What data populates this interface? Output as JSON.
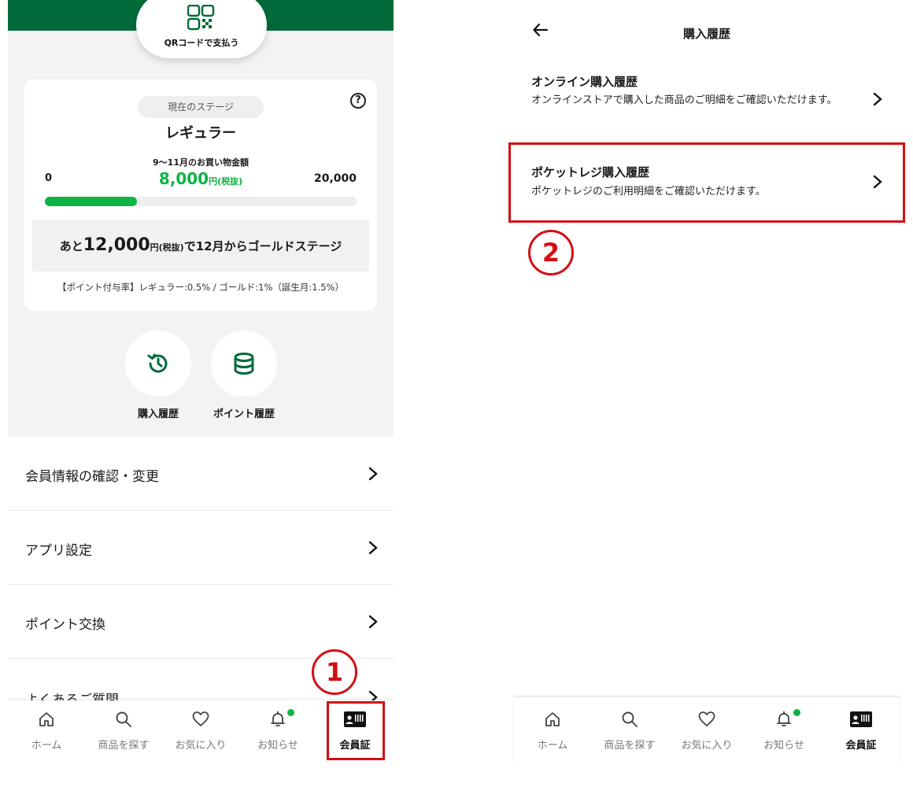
{
  "left": {
    "qr_label": "QRコードで支払う",
    "stage": {
      "badge": "現在のステージ",
      "name": "レギュラー",
      "period_label": "9〜11月のお買い物金額",
      "range_min": "0",
      "range_max": "20,000",
      "amount_value": "8,000",
      "amount_unit": "円(税抜)",
      "progress_fraction": 0.4,
      "remain_prefix": "あと",
      "remain_value": "12,000",
      "remain_unit": "円(税抜)",
      "remain_suffix": "で12月からゴールドステージ",
      "rate_note": "【ポイント付与率】レギュラー:0.5% / ゴールド:1%（誕生月:1.5%）"
    },
    "history_buttons": [
      {
        "label": "購入履歴",
        "icon": "history-icon"
      },
      {
        "label": "ポイント履歴",
        "icon": "database-icon"
      }
    ],
    "menu": [
      {
        "label": "会員情報の確認・変更"
      },
      {
        "label": "アプリ設定"
      },
      {
        "label": "ポイント交換"
      },
      {
        "label": "よくあるご質問"
      }
    ]
  },
  "tabbar": {
    "tabs": [
      {
        "label": "ホーム",
        "icon": "home-icon"
      },
      {
        "label": "商品を探す",
        "icon": "search-icon"
      },
      {
        "label": "お気に入り",
        "icon": "heart-icon"
      },
      {
        "label": "お知らせ",
        "icon": "bell-icon"
      },
      {
        "label": "会員証",
        "icon": "member-card-icon"
      }
    ],
    "active_index": 4
  },
  "right": {
    "title": "購入履歴",
    "items": [
      {
        "title": "オンライン購入履歴",
        "desc": "オンラインストアで購入した商品のご明細をご確認いただけます。"
      },
      {
        "title": "ポケットレジ購入履歴",
        "desc": "ポケットレジのご利用明細をご確認いただけます。"
      }
    ]
  },
  "annotations": {
    "step1": "1",
    "step2": "2",
    "color": "#d40f14"
  },
  "colors": {
    "brand_green": "#006a3a",
    "accent_green": "#0eb345"
  }
}
